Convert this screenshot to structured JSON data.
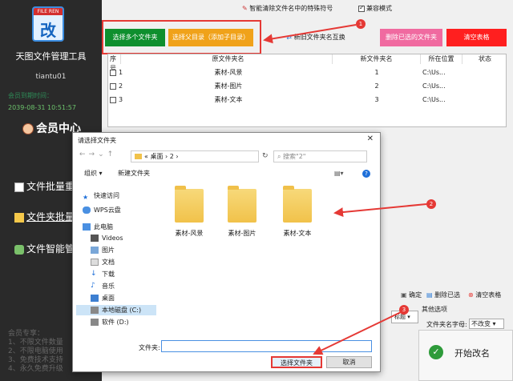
{
  "sidebar": {
    "logo_badge": "FILE REN",
    "logo_char": "改",
    "app_name": "天图文件管理工具",
    "user": "tiantu01",
    "expire_label": "会员到期时间：",
    "expire_date": "2039-08-31 10:51:57",
    "member_center": "会员中心",
    "items": [
      {
        "label": "文件批量重命",
        "icon": "document-icon"
      },
      {
        "label": "文件夹批量改",
        "icon": "folder-icon"
      },
      {
        "label": "文件智能管理",
        "icon": "gamepad-icon"
      }
    ],
    "notes": [
      "会员专享：",
      "1、不限文件数量",
      "2、不限电脑使用",
      "3、免费技术支持",
      "4、永久免费升级"
    ]
  },
  "top": {
    "feature": "智能清除文件名中的特殊符号",
    "compat_label": "兼容模式"
  },
  "toolbar": {
    "select_folders": "选择多个文件夹",
    "select_parent": "选择父目录（添加子目录）",
    "swap_names": "新旧文件夹名互换",
    "delete_selected": "删除已选的文件夹",
    "clear_table": "清空表格"
  },
  "table": {
    "headers": [
      "序号",
      "原文件夹名",
      "新文件夹名",
      "所在位置",
      "状态"
    ],
    "rows": [
      {
        "no": "1",
        "old": "素材-风景",
        "new": "1",
        "loc": "C:\\Us..."
      },
      {
        "no": "2",
        "old": "素材-图片",
        "new": "2",
        "loc": "C:\\Us..."
      },
      {
        "no": "3",
        "old": "素材-文本",
        "new": "3",
        "loc": "C:\\Us..."
      }
    ]
  },
  "dialog": {
    "title": "请选择文件夹",
    "path": [
      "«",
      "桌面",
      "›",
      "2",
      "›"
    ],
    "search_placeholder": "搜索\"2\"",
    "organize": "组织 ▾",
    "new_folder": "新建文件夹",
    "nav": [
      {
        "label": "快速访问",
        "icon": "star-icon"
      },
      {
        "label": "WPS云盘",
        "icon": "cloud-icon"
      },
      {
        "label": "此电脑",
        "icon": "computer-icon"
      },
      {
        "label": "Videos",
        "icon": "video-icon"
      },
      {
        "label": "图片",
        "icon": "picture-icon"
      },
      {
        "label": "文档",
        "icon": "document-icon"
      },
      {
        "label": "下载",
        "icon": "download-icon"
      },
      {
        "label": "音乐",
        "icon": "music-icon"
      },
      {
        "label": "桌面",
        "icon": "desktop-icon"
      },
      {
        "label": "本地磁盘 (C:)",
        "icon": "drive-icon"
      },
      {
        "label": "软件 (D:)",
        "icon": "drive-icon"
      }
    ],
    "folders": [
      "素材-风景",
      "素材-图片",
      "素材-文本"
    ],
    "folder_label": "文件夹:",
    "select_button": "选择文件夹",
    "cancel_button": "取消"
  },
  "bottom": {
    "confirm": "确定",
    "delete_selected": "删除已选",
    "clear_table": "清空表格",
    "other_options": "其他选项",
    "case_label": "文件夹名字母:",
    "case_value": "不改变",
    "title_suffix": "标题",
    "start": "开始改名"
  },
  "annotations": [
    "1",
    "2",
    "3"
  ],
  "colors": {
    "green": "#0e8f2e",
    "orange": "#f0a21a",
    "pink": "#f06aa0",
    "red": "#ff1f1f",
    "annotation": "#e53935"
  }
}
